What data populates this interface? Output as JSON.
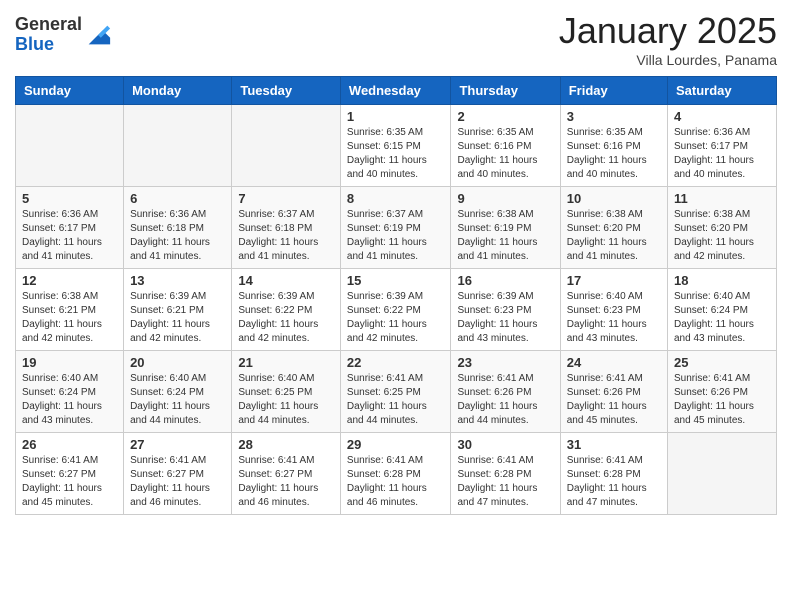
{
  "header": {
    "logo_general": "General",
    "logo_blue": "Blue",
    "month": "January 2025",
    "location": "Villa Lourdes, Panama"
  },
  "days_of_week": [
    "Sunday",
    "Monday",
    "Tuesday",
    "Wednesday",
    "Thursday",
    "Friday",
    "Saturday"
  ],
  "weeks": [
    [
      {
        "day": "",
        "info": ""
      },
      {
        "day": "",
        "info": ""
      },
      {
        "day": "",
        "info": ""
      },
      {
        "day": "1",
        "info": "Sunrise: 6:35 AM\nSunset: 6:15 PM\nDaylight: 11 hours and 40 minutes."
      },
      {
        "day": "2",
        "info": "Sunrise: 6:35 AM\nSunset: 6:16 PM\nDaylight: 11 hours and 40 minutes."
      },
      {
        "day": "3",
        "info": "Sunrise: 6:35 AM\nSunset: 6:16 PM\nDaylight: 11 hours and 40 minutes."
      },
      {
        "day": "4",
        "info": "Sunrise: 6:36 AM\nSunset: 6:17 PM\nDaylight: 11 hours and 40 minutes."
      }
    ],
    [
      {
        "day": "5",
        "info": "Sunrise: 6:36 AM\nSunset: 6:17 PM\nDaylight: 11 hours and 41 minutes."
      },
      {
        "day": "6",
        "info": "Sunrise: 6:36 AM\nSunset: 6:18 PM\nDaylight: 11 hours and 41 minutes."
      },
      {
        "day": "7",
        "info": "Sunrise: 6:37 AM\nSunset: 6:18 PM\nDaylight: 11 hours and 41 minutes."
      },
      {
        "day": "8",
        "info": "Sunrise: 6:37 AM\nSunset: 6:19 PM\nDaylight: 11 hours and 41 minutes."
      },
      {
        "day": "9",
        "info": "Sunrise: 6:38 AM\nSunset: 6:19 PM\nDaylight: 11 hours and 41 minutes."
      },
      {
        "day": "10",
        "info": "Sunrise: 6:38 AM\nSunset: 6:20 PM\nDaylight: 11 hours and 41 minutes."
      },
      {
        "day": "11",
        "info": "Sunrise: 6:38 AM\nSunset: 6:20 PM\nDaylight: 11 hours and 42 minutes."
      }
    ],
    [
      {
        "day": "12",
        "info": "Sunrise: 6:38 AM\nSunset: 6:21 PM\nDaylight: 11 hours and 42 minutes."
      },
      {
        "day": "13",
        "info": "Sunrise: 6:39 AM\nSunset: 6:21 PM\nDaylight: 11 hours and 42 minutes."
      },
      {
        "day": "14",
        "info": "Sunrise: 6:39 AM\nSunset: 6:22 PM\nDaylight: 11 hours and 42 minutes."
      },
      {
        "day": "15",
        "info": "Sunrise: 6:39 AM\nSunset: 6:22 PM\nDaylight: 11 hours and 42 minutes."
      },
      {
        "day": "16",
        "info": "Sunrise: 6:39 AM\nSunset: 6:23 PM\nDaylight: 11 hours and 43 minutes."
      },
      {
        "day": "17",
        "info": "Sunrise: 6:40 AM\nSunset: 6:23 PM\nDaylight: 11 hours and 43 minutes."
      },
      {
        "day": "18",
        "info": "Sunrise: 6:40 AM\nSunset: 6:24 PM\nDaylight: 11 hours and 43 minutes."
      }
    ],
    [
      {
        "day": "19",
        "info": "Sunrise: 6:40 AM\nSunset: 6:24 PM\nDaylight: 11 hours and 43 minutes."
      },
      {
        "day": "20",
        "info": "Sunrise: 6:40 AM\nSunset: 6:24 PM\nDaylight: 11 hours and 44 minutes."
      },
      {
        "day": "21",
        "info": "Sunrise: 6:40 AM\nSunset: 6:25 PM\nDaylight: 11 hours and 44 minutes."
      },
      {
        "day": "22",
        "info": "Sunrise: 6:41 AM\nSunset: 6:25 PM\nDaylight: 11 hours and 44 minutes."
      },
      {
        "day": "23",
        "info": "Sunrise: 6:41 AM\nSunset: 6:26 PM\nDaylight: 11 hours and 44 minutes."
      },
      {
        "day": "24",
        "info": "Sunrise: 6:41 AM\nSunset: 6:26 PM\nDaylight: 11 hours and 45 minutes."
      },
      {
        "day": "25",
        "info": "Sunrise: 6:41 AM\nSunset: 6:26 PM\nDaylight: 11 hours and 45 minutes."
      }
    ],
    [
      {
        "day": "26",
        "info": "Sunrise: 6:41 AM\nSunset: 6:27 PM\nDaylight: 11 hours and 45 minutes."
      },
      {
        "day": "27",
        "info": "Sunrise: 6:41 AM\nSunset: 6:27 PM\nDaylight: 11 hours and 46 minutes."
      },
      {
        "day": "28",
        "info": "Sunrise: 6:41 AM\nSunset: 6:27 PM\nDaylight: 11 hours and 46 minutes."
      },
      {
        "day": "29",
        "info": "Sunrise: 6:41 AM\nSunset: 6:28 PM\nDaylight: 11 hours and 46 minutes."
      },
      {
        "day": "30",
        "info": "Sunrise: 6:41 AM\nSunset: 6:28 PM\nDaylight: 11 hours and 47 minutes."
      },
      {
        "day": "31",
        "info": "Sunrise: 6:41 AM\nSunset: 6:28 PM\nDaylight: 11 hours and 47 minutes."
      },
      {
        "day": "",
        "info": ""
      }
    ]
  ]
}
